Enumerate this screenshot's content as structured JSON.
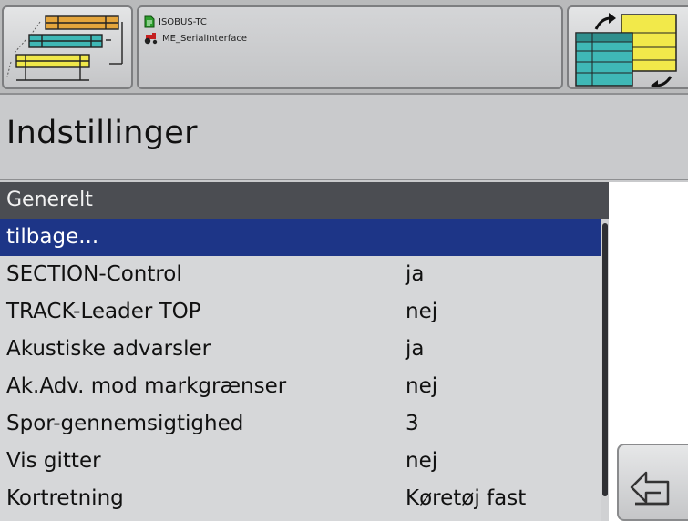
{
  "header": {
    "left_button_icon": "field-map-lanes-icon",
    "right_button_icon": "switch-screen-icon",
    "info": [
      {
        "icon": "document-icon",
        "text": "ISOBUS-TC"
      },
      {
        "icon": "tractor-icon",
        "text": "ME_SerialInterface"
      }
    ]
  },
  "page": {
    "title": "Indstillinger"
  },
  "settings": {
    "header": "Generelt",
    "rows": [
      {
        "label": "tilbage...",
        "value": "",
        "selected": true
      },
      {
        "label": "SECTION-Control",
        "value": "ja"
      },
      {
        "label": "TRACK-Leader TOP",
        "value": "nej"
      },
      {
        "label": "Akustiske advarsler",
        "value": "ja"
      },
      {
        "label": "Ak.Adv. mod markgrænser",
        "value": "nej"
      },
      {
        "label": "Spor-gennemsigtighed",
        "value": "3"
      },
      {
        "label": "Vis gitter",
        "value": "nej"
      },
      {
        "label": "Kortretning",
        "value": "Køretøj fast"
      }
    ]
  },
  "back_button": {
    "icon": "back-arrow-icon"
  },
  "colors": {
    "selection": "#1d3587",
    "header_bar": "#4b4d52",
    "panel": "#d6d7d9"
  }
}
